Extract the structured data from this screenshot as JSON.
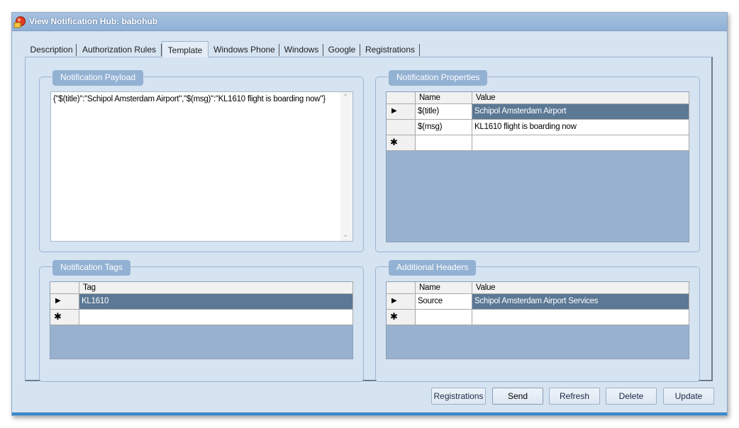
{
  "window": {
    "title": "View Notification Hub: babohub"
  },
  "tabs": [
    {
      "label": "Description"
    },
    {
      "label": "Authorization Rules"
    },
    {
      "label": "Template"
    },
    {
      "label": "Windows Phone"
    },
    {
      "label": "Windows"
    },
    {
      "label": "Google"
    },
    {
      "label": "Registrations"
    }
  ],
  "active_tab": "Template",
  "payload": {
    "label": "Notification Payload",
    "value": "{\"$(title)\":\"Schipol Amsterdam Airport\",\"$(msg)\":\"KL1610 flight is boarding now\"}"
  },
  "properties": {
    "label": "Notification Properties",
    "columns": [
      "Name",
      "Value"
    ],
    "rows": [
      {
        "name": "$(title)",
        "value": "Schipol Amsterdam Airport"
      },
      {
        "name": "$(msg)",
        "value": "KL1610 flight is boarding now"
      }
    ]
  },
  "tags": {
    "label": "Notification Tags",
    "columns": [
      "Tag"
    ],
    "rows": [
      {
        "tag": "KL1610"
      }
    ]
  },
  "headers": {
    "label": "Additional Headers",
    "columns": [
      "Name",
      "Value"
    ],
    "rows": [
      {
        "name": "Source",
        "value": "Schipol Amsterdam Airport Services"
      }
    ]
  },
  "buttons": {
    "registrations": "Registrations",
    "send": "Send",
    "refresh": "Refresh",
    "delete": "Delete",
    "update": "Update"
  },
  "glyphs": {
    "current_row": "▶",
    "new_row": "✱",
    "scroll_up": "⌃",
    "scroll_down": "⌄"
  },
  "colors": {
    "selected_row": "#5b7894",
    "group_label": "#93b1d3",
    "window_bg": "#d6e3f1"
  }
}
